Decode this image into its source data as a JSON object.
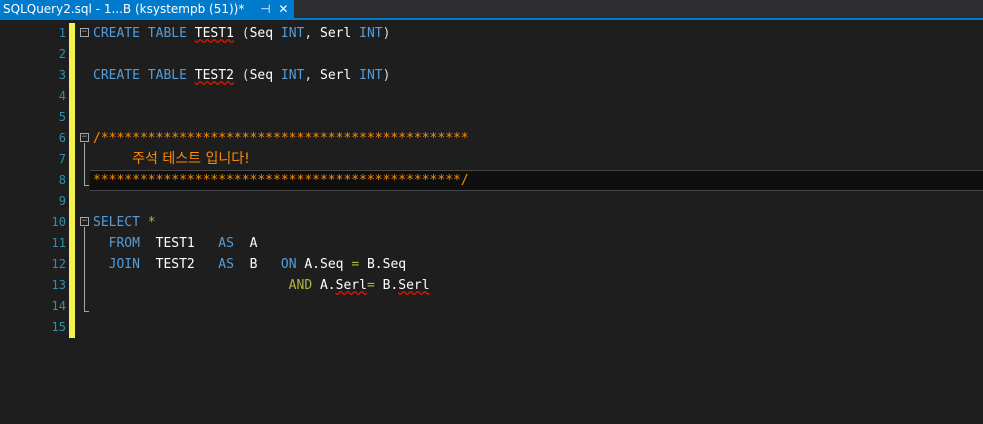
{
  "tab": {
    "title": "SQLQuery2.sql - 1...B (ksystempb (51))*",
    "pin_glyph": "⊣",
    "close_glyph": "✕"
  },
  "editor": {
    "current_line": 8,
    "lines": [
      {
        "n": "1",
        "tokens": [
          [
            "CREATE",
            "kw"
          ],
          [
            " ",
            ""
          ],
          [
            "TABLE",
            "kw"
          ],
          [
            " ",
            ""
          ],
          [
            "TEST1",
            "id sq"
          ],
          [
            " (",
            ""
          ],
          [
            "Seq",
            "id"
          ],
          [
            " ",
            ""
          ],
          [
            "INT",
            "ty"
          ],
          [
            ", ",
            ""
          ],
          [
            "Serl",
            "id"
          ],
          [
            " ",
            ""
          ],
          [
            "INT",
            "ty"
          ],
          [
            ")",
            ""
          ]
        ]
      },
      {
        "n": "2",
        "tokens": []
      },
      {
        "n": "3",
        "tokens": [
          [
            "CREATE",
            "kw"
          ],
          [
            " ",
            ""
          ],
          [
            "TABLE",
            "kw"
          ],
          [
            " ",
            ""
          ],
          [
            "TEST2",
            "id sq"
          ],
          [
            " (",
            ""
          ],
          [
            "Seq",
            "id"
          ],
          [
            " ",
            ""
          ],
          [
            "INT",
            "ty"
          ],
          [
            ", ",
            ""
          ],
          [
            "Serl",
            "id"
          ],
          [
            " ",
            ""
          ],
          [
            "INT",
            "ty"
          ],
          [
            ")",
            ""
          ]
        ]
      },
      {
        "n": "4",
        "tokens": []
      },
      {
        "n": "5",
        "tokens": []
      },
      {
        "n": "6",
        "tokens": [
          [
            "/***********************************************",
            "cm"
          ]
        ]
      },
      {
        "n": "7",
        "tokens": [
          [
            "     ",
            ""
          ],
          [
            "주석 테스트 입니다!",
            "kor"
          ]
        ]
      },
      {
        "n": "8",
        "tokens": [
          [
            "***********************************************/",
            "cm"
          ]
        ]
      },
      {
        "n": "9",
        "tokens": []
      },
      {
        "n": "10",
        "tokens": [
          [
            "SELECT",
            "kw"
          ],
          [
            " ",
            ""
          ],
          [
            "*",
            "op"
          ]
        ]
      },
      {
        "n": "11",
        "tokens": [
          [
            "  ",
            ""
          ],
          [
            "FROM",
            "kw"
          ],
          [
            "  ",
            ""
          ],
          [
            "TEST1",
            "id"
          ],
          [
            "   ",
            ""
          ],
          [
            "AS",
            "kw"
          ],
          [
            "  ",
            ""
          ],
          [
            "A",
            "id"
          ]
        ]
      },
      {
        "n": "12",
        "tokens": [
          [
            "  ",
            ""
          ],
          [
            "JOIN",
            "kw"
          ],
          [
            "  ",
            ""
          ],
          [
            "TEST2",
            "id"
          ],
          [
            "   ",
            ""
          ],
          [
            "AS",
            "kw"
          ],
          [
            "  ",
            ""
          ],
          [
            "B",
            "id"
          ],
          [
            "   ",
            ""
          ],
          [
            "ON",
            "kw"
          ],
          [
            " ",
            ""
          ],
          [
            "A.Seq",
            "id"
          ],
          [
            " ",
            ""
          ],
          [
            "=",
            "op"
          ],
          [
            " ",
            ""
          ],
          [
            "B.Seq",
            "id"
          ]
        ]
      },
      {
        "n": "13",
        "tokens": [
          [
            "                         ",
            ""
          ],
          [
            "AND",
            "op"
          ],
          [
            " ",
            ""
          ],
          [
            "A.",
            "id"
          ],
          [
            "Serl",
            "id sq"
          ],
          [
            "=",
            "op"
          ],
          [
            " ",
            ""
          ],
          [
            "B.",
            "id"
          ],
          [
            "Serl",
            "id sq"
          ]
        ]
      },
      {
        "n": "14",
        "tokens": []
      },
      {
        "n": "15",
        "tokens": []
      }
    ]
  }
}
